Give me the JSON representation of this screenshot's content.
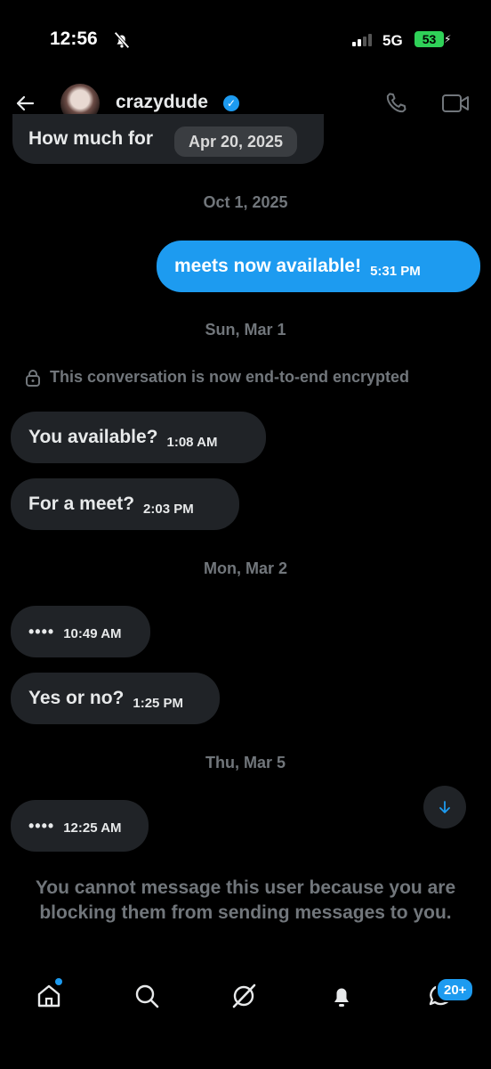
{
  "status_bar": {
    "time": "12:56",
    "network": "5G",
    "battery": "53"
  },
  "header": {
    "username": "crazydude",
    "verified_mark": "✓",
    "icons": [
      "back-arrow-icon",
      "phone-icon",
      "video-icon"
    ]
  },
  "thread": {
    "top_message_text": "How much for",
    "date_pill": "Apr 20, 2025",
    "dates": [
      "Oct 1, 2025",
      "Sun, Mar 1",
      "Mon, Mar 2",
      "Thu, Mar 5"
    ],
    "encryption_notice": "This conversation is now end-to-end encrypted",
    "messages": [
      {
        "text": "meets now available!",
        "time": "5:31 PM",
        "from": "me"
      },
      {
        "text": "You available?",
        "time": "1:08 AM",
        "from": "them"
      },
      {
        "text": "For a meet?",
        "time": "2:03 PM",
        "from": "them"
      },
      {
        "text": "••••",
        "time": "10:49 AM",
        "from": "them"
      },
      {
        "text": "Yes or no?",
        "time": "1:25 PM",
        "from": "them"
      },
      {
        "text": "••••",
        "time": "12:25 AM",
        "from": "them"
      }
    ],
    "blocked_notice": "You cannot message this user because you are blocking them from sending messages to you."
  },
  "nav": {
    "messages_badge": "20+",
    "items": [
      "home-icon",
      "search-icon",
      "grok-icon",
      "notifications-icon",
      "messages-icon"
    ]
  },
  "colors": {
    "accent": "#1d9bf0",
    "bubble_in": "#202327",
    "muted": "#71767b"
  }
}
